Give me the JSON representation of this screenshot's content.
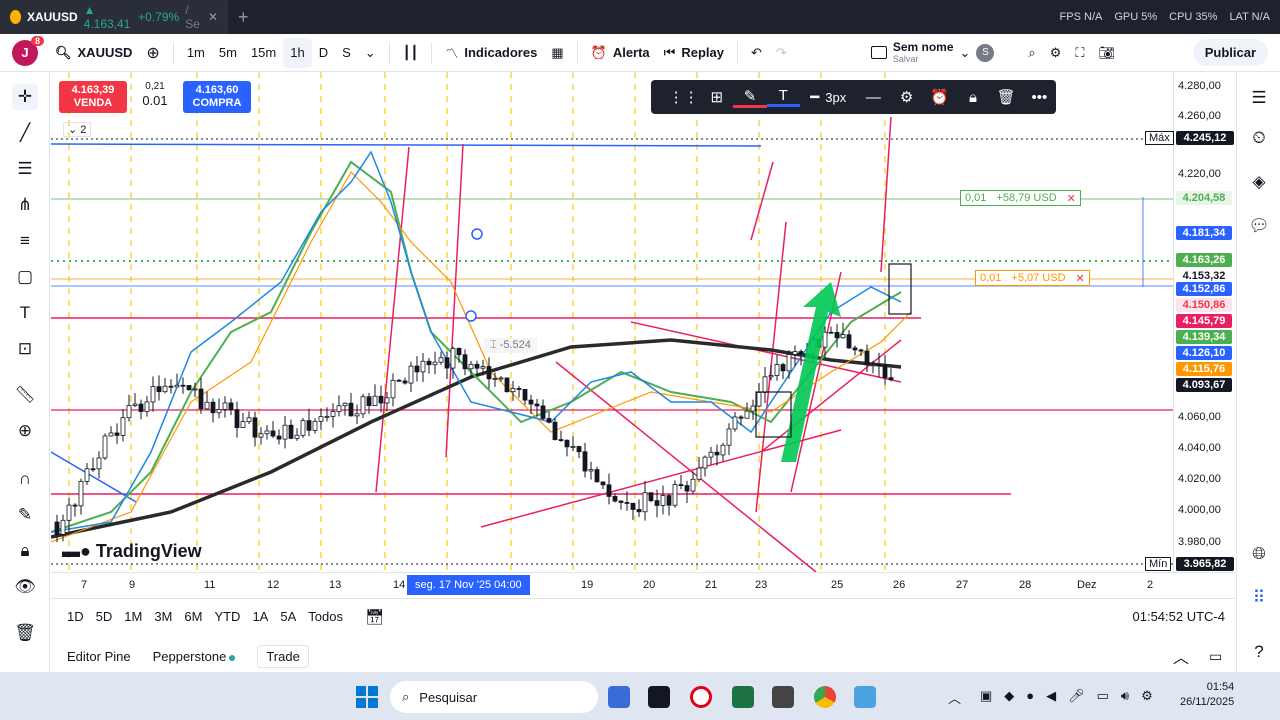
{
  "browser": {
    "tab_ticker": "XAUUSD",
    "tab_price": "▲ 4.163,41",
    "tab_change": "+0.79%",
    "tab_suffix": "/ Se",
    "new_tab": "+",
    "stats": [
      "FPS N/A",
      "GPU 5%",
      "CPU 35%",
      "LAT N/A"
    ]
  },
  "toolbar": {
    "avatar_letter": "J",
    "avatar_badge": "8",
    "symbol": "XAUUSD",
    "intervals": [
      "1m",
      "5m",
      "15m",
      "1h",
      "D",
      "S"
    ],
    "active_interval": "1h",
    "indicators_label": "Indicadores",
    "alert_label": "Alerta",
    "replay_label": "Replay",
    "layout_name": "Sem nome",
    "layout_sub": "Salvar",
    "layout_badge": "S",
    "publish_label": "Publicar"
  },
  "trade_widget": {
    "sell_price": "4.163,39",
    "sell_label": "VENDA",
    "spread": "0,21",
    "lot": "0.01",
    "buy_price": "4.163,60",
    "buy_label": "COMPRA",
    "collapse_count": "2"
  },
  "price_axis": {
    "labels": [
      "4.280,00",
      "4.260,00",
      "4.220,00",
      "4.060,00",
      "4.040,00",
      "4.020,00",
      "4.000,00",
      "3.980,00"
    ],
    "max_label": "Máx",
    "max_value": "4.245,12",
    "min_label": "Mín",
    "min_value": "3.965,82",
    "tags": [
      {
        "text": "4.204,58",
        "color": "#e8f5e9",
        "fg": "#4caf50"
      },
      {
        "text": "4.181,34",
        "color": "#2962ff",
        "fg": "#ffffff"
      },
      {
        "text": "4.163,26",
        "color": "#4caf50",
        "fg": "#ffffff"
      },
      {
        "text": "4.153,32",
        "color": "#ffffff",
        "fg": "#131722"
      },
      {
        "text": "4.152,86",
        "color": "#2962ff",
        "fg": "#ffffff"
      },
      {
        "text": "4.150,86",
        "color": "#fce4ec",
        "fg": "#f23645"
      },
      {
        "text": "4.145,79",
        "color": "#e91e63",
        "fg": "#ffffff"
      },
      {
        "text": "4.139,34",
        "color": "#4caf50",
        "fg": "#ffffff"
      },
      {
        "text": "4.126,10",
        "color": "#2962ff",
        "fg": "#ffffff"
      },
      {
        "text": "4.115,76",
        "color": "#ff9800",
        "fg": "#ffffff"
      },
      {
        "text": "4.093,67",
        "color": "#131722",
        "fg": "#ffffff"
      }
    ]
  },
  "time_axis": {
    "labels": [
      "7",
      "9",
      "11",
      "12",
      "13",
      "14",
      "19",
      "20",
      "21",
      "23",
      "25",
      "26",
      "27",
      "28",
      "Dez",
      "2"
    ],
    "cursor_label": "seg. 17 Nov '25  04:00"
  },
  "drawing_toolbar": {
    "width_label": "3px"
  },
  "chart_labels": {
    "measure": "-5.524",
    "position_top": {
      "qty": "0,01",
      "pnl": "+58,79 USD"
    },
    "position_bottom": {
      "qty": "0,01",
      "pnl": "+5,07 USD"
    }
  },
  "watermark": "TradingView",
  "range_bar": {
    "ranges": [
      "1D",
      "5D",
      "1M",
      "3M",
      "6M",
      "YTD",
      "1A",
      "5A",
      "Todos"
    ],
    "clock": "01:54:52 UTC-4"
  },
  "panel_bar": {
    "pine": "Editor Pine",
    "broker": "Pepperstone",
    "trade": "Trade"
  },
  "taskbar": {
    "search_placeholder": "Pesquisar",
    "time": "01:54",
    "date": "26/11/2025"
  },
  "colors": {
    "sell": "#f23645",
    "buy": "#2962ff",
    "green": "#4caf50",
    "ma_black": "#2a2a2a",
    "pink": "#e91e63",
    "orange": "#ff9800"
  }
}
